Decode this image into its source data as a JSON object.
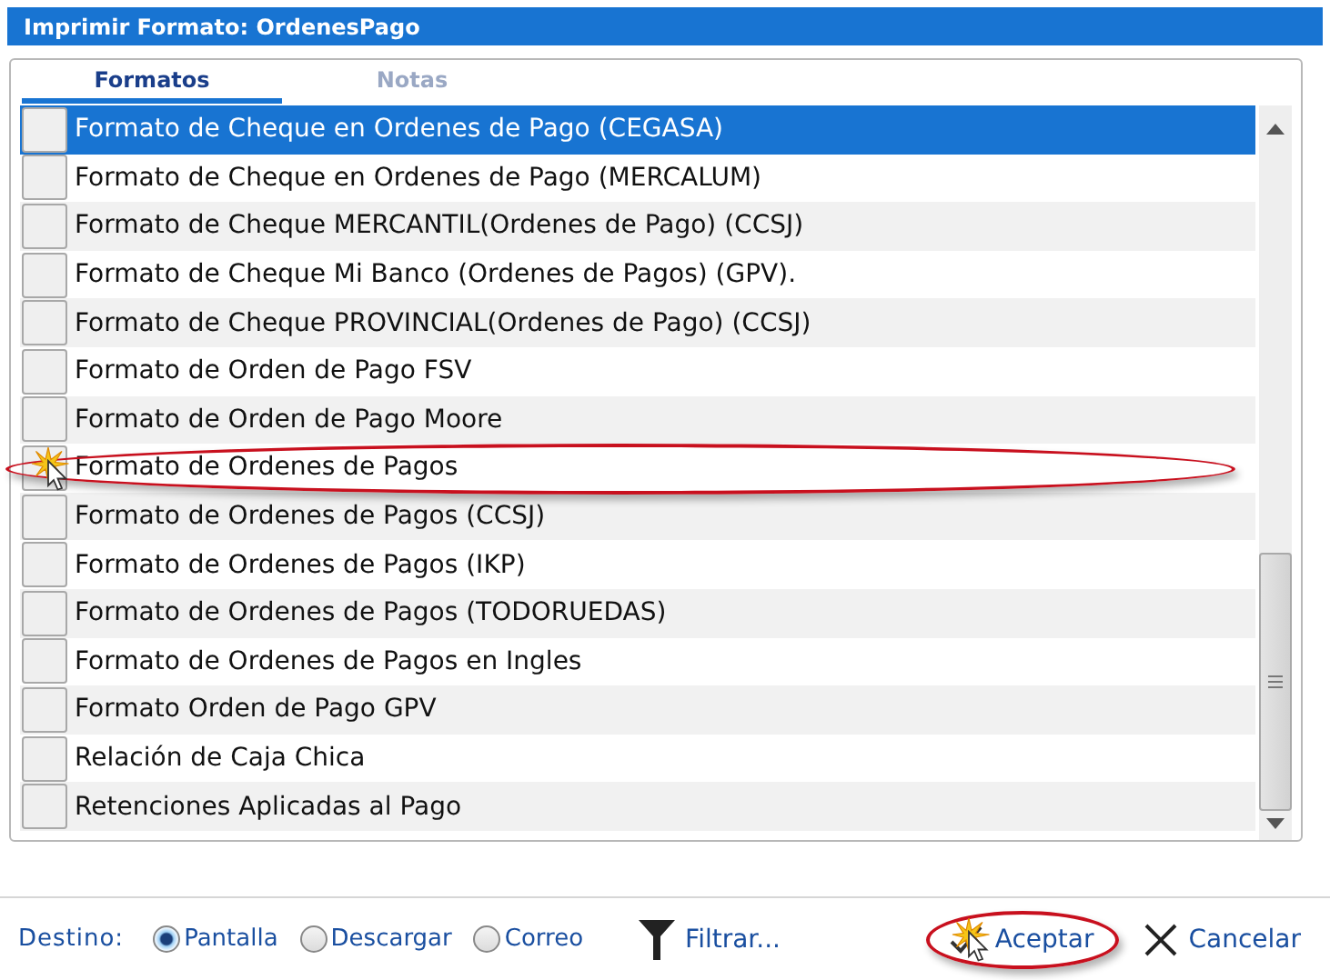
{
  "window": {
    "title": "Imprimir Formato: OrdenesPago"
  },
  "tabs": [
    {
      "label": "Formatos",
      "selected": true
    },
    {
      "label": "Notas",
      "selected": false
    }
  ],
  "formats": [
    {
      "label": "Formato de Cheque en Ordenes de Pago (CEGASA)",
      "selected": true,
      "annotated": false
    },
    {
      "label": "Formato de Cheque en Ordenes de Pago (MERCALUM)",
      "selected": false,
      "annotated": false
    },
    {
      "label": "Formato de Cheque MERCANTIL(Ordenes de Pago) (CCSJ)",
      "selected": false,
      "annotated": false
    },
    {
      "label": "Formato de Cheque Mi Banco (Ordenes de Pagos) (GPV).",
      "selected": false,
      "annotated": false
    },
    {
      "label": "Formato de Cheque PROVINCIAL(Ordenes de Pago) (CCSJ)",
      "selected": false,
      "annotated": false
    },
    {
      "label": "Formato de Orden de Pago FSV",
      "selected": false,
      "annotated": false
    },
    {
      "label": "Formato de Orden de Pago Moore",
      "selected": false,
      "annotated": false
    },
    {
      "label": "Formato de Ordenes de Pagos",
      "selected": false,
      "annotated": true
    },
    {
      "label": "Formato de Ordenes de Pagos (CCSJ)",
      "selected": false,
      "annotated": false
    },
    {
      "label": "Formato de Ordenes de Pagos (IKP)",
      "selected": false,
      "annotated": false
    },
    {
      "label": "Formato de Ordenes de Pagos (TODORUEDAS)",
      "selected": false,
      "annotated": false
    },
    {
      "label": "Formato de Ordenes de Pagos en Ingles",
      "selected": false,
      "annotated": false
    },
    {
      "label": "Formato Orden de Pago GPV",
      "selected": false,
      "annotated": false
    },
    {
      "label": "Relación de Caja Chica",
      "selected": false,
      "annotated": false
    },
    {
      "label": "Retenciones Aplicadas al Pago",
      "selected": false,
      "annotated": false
    }
  ],
  "footer": {
    "destination_label": "Destino:",
    "destinations": [
      {
        "label": "Pantalla",
        "selected": true
      },
      {
        "label": "Descargar",
        "selected": false
      },
      {
        "label": "Correo",
        "selected": false
      }
    ],
    "filter_button": "Filtrar...",
    "buttons": [
      {
        "label": "Aceptar",
        "kind": "accept",
        "annotated": true
      },
      {
        "label": "Cancelar",
        "kind": "cancel",
        "annotated": false
      }
    ]
  }
}
